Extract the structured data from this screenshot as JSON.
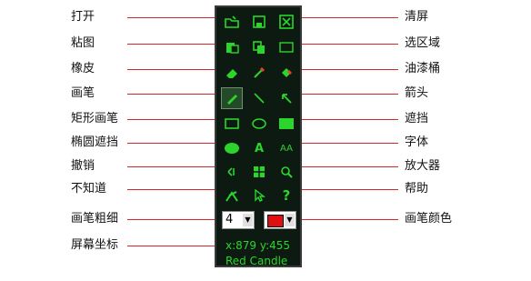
{
  "left_labels": [
    "打开",
    "粘图",
    "橡皮",
    "画笔",
    "矩形画笔",
    "椭圆遮挡",
    "撤销",
    "不知道",
    "画笔粗细",
    "屏幕坐标"
  ],
  "right_labels": [
    "清屏",
    "选区域",
    "油漆桶",
    "箭头",
    "遮挡",
    "字体",
    "放大器",
    "帮助",
    "画笔颜色"
  ],
  "tools": [
    {
      "name": "open-icon",
      "glyph": ""
    },
    {
      "name": "save-icon",
      "glyph": ""
    },
    {
      "name": "clear-screen-icon",
      "glyph": ""
    },
    {
      "name": "paste-image-icon",
      "glyph": ""
    },
    {
      "name": "copy-icon",
      "glyph": ""
    },
    {
      "name": "select-region-icon",
      "glyph": ""
    },
    {
      "name": "eraser-icon",
      "glyph": ""
    },
    {
      "name": "eyedropper-icon",
      "glyph": ""
    },
    {
      "name": "paint-bucket-icon",
      "glyph": ""
    },
    {
      "name": "pen-icon",
      "glyph": ""
    },
    {
      "name": "line-icon",
      "glyph": ""
    },
    {
      "name": "arrow-icon",
      "glyph": ""
    },
    {
      "name": "rectangle-pen-icon",
      "glyph": ""
    },
    {
      "name": "ellipse-pen-icon",
      "glyph": ""
    },
    {
      "name": "filled-rectangle-mask-icon",
      "glyph": ""
    },
    {
      "name": "filled-ellipse-mask-icon",
      "glyph": ""
    },
    {
      "name": "text-icon",
      "glyph": "A"
    },
    {
      "name": "font-icon",
      "glyph": "AA"
    },
    {
      "name": "undo-icon",
      "glyph": ""
    },
    {
      "name": "grid-icon",
      "glyph": ""
    },
    {
      "name": "magnifier-icon",
      "glyph": ""
    },
    {
      "name": "unknown-tool-icon",
      "glyph": ""
    },
    {
      "name": "pointer-icon",
      "glyph": ""
    },
    {
      "name": "help-icon",
      "glyph": "?"
    }
  ],
  "pen_width": {
    "value": "4",
    "arrow": "▼"
  },
  "pen_color": {
    "color": "#e01010",
    "arrow": "▼"
  },
  "coords": "x:879  y:455",
  "status": "Red Candle",
  "colors": {
    "panel_bg": "#0c1a12",
    "tool_green": "#2bd52b",
    "leader_line": "#d6262b"
  }
}
